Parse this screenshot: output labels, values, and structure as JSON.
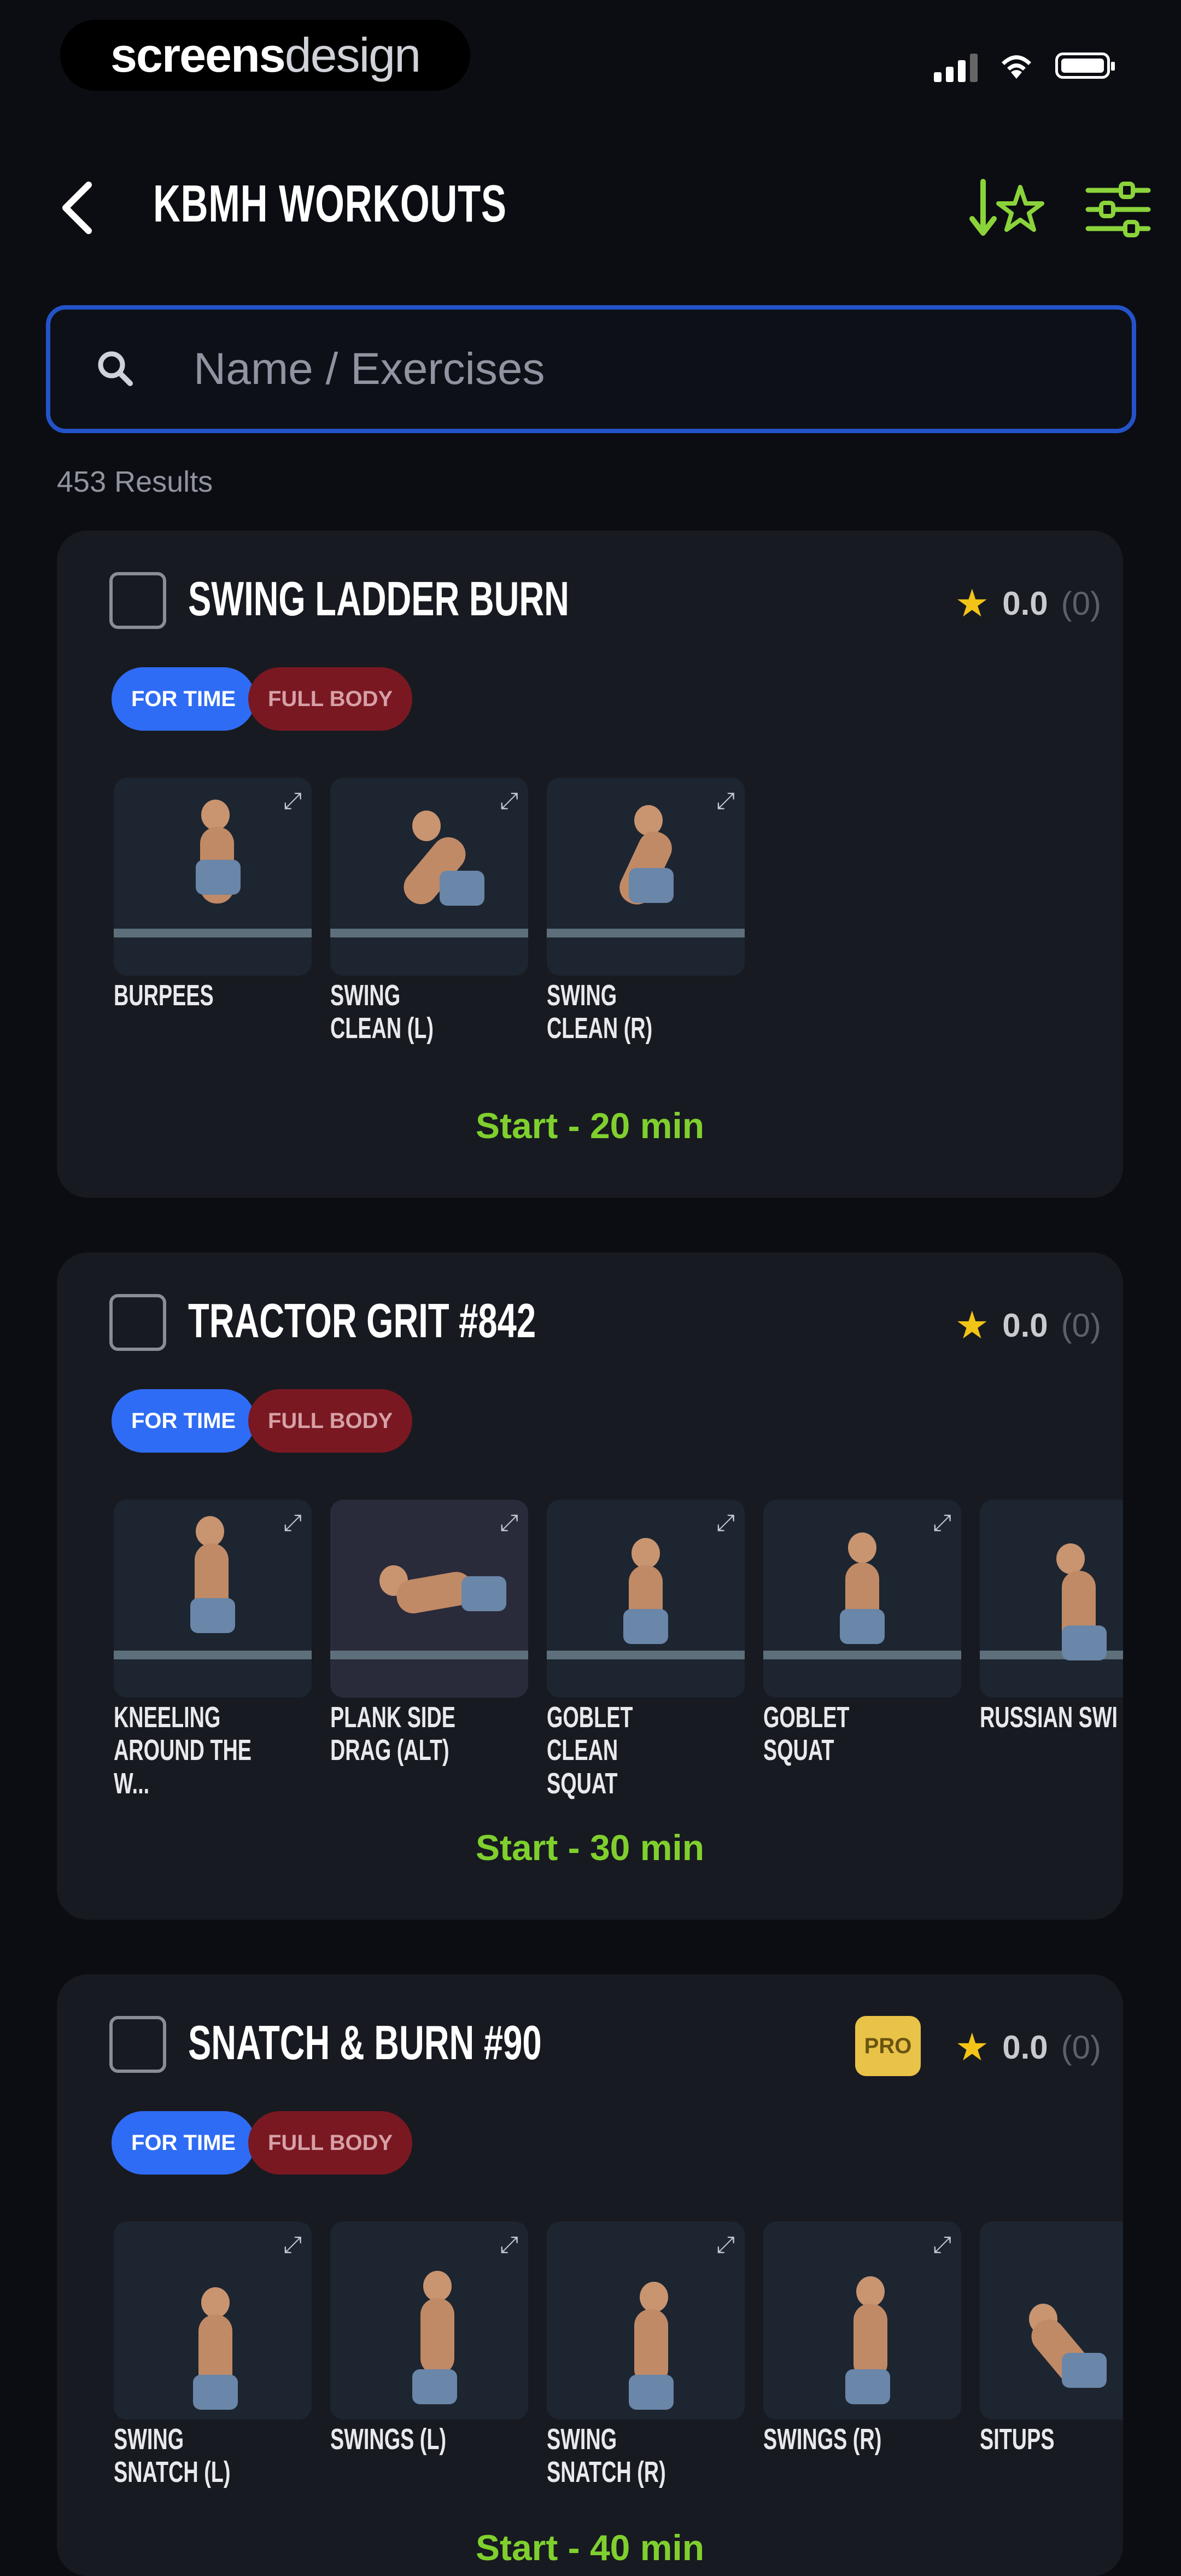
{
  "status_bar": {
    "brand_bold": "screens",
    "brand_light": "design"
  },
  "header": {
    "title": "KBMH WORKOUTS",
    "sort_icon": "sort-star-icon",
    "filter_icon": "filter-sliders-icon"
  },
  "search": {
    "placeholder": "Name / Exercises",
    "value": ""
  },
  "results_label": "453 Results",
  "colors": {
    "accent_green": "#7fd02e",
    "search_border": "#2453c9",
    "tag_blue": "#2f6cf5",
    "tag_red": "#7a1822",
    "star": "#f2c418"
  },
  "workouts": [
    {
      "title": "SWING LADDER BURN",
      "pro": false,
      "rating": "0.0",
      "rating_count": "(0)",
      "tags": [
        "FOR TIME",
        "FULL BODY"
      ],
      "exercises": [
        "BURPEES",
        "SWING CLEAN (L)",
        "SWING CLEAN (R)"
      ],
      "start_label": "Start - 20 min"
    },
    {
      "title": "TRACTOR GRIT #842",
      "pro": false,
      "rating": "0.0",
      "rating_count": "(0)",
      "tags": [
        "FOR TIME",
        "FULL BODY"
      ],
      "exercises": [
        "KNEELING AROUND THE W...",
        "PLANK SIDE DRAG (ALT)",
        "GOBLET CLEAN SQUAT",
        "GOBLET SQUAT",
        "RUSSIAN SWI"
      ],
      "start_label": "Start - 30 min"
    },
    {
      "title": "SNATCH & BURN #90",
      "pro": true,
      "pro_label": "PRO",
      "rating": "0.0",
      "rating_count": "(0)",
      "tags": [
        "FOR TIME",
        "FULL BODY"
      ],
      "exercises": [
        "SWING SNATCH (L)",
        "SWINGS (L)",
        "SWING SNATCH (R)",
        "SWINGS (R)",
        "SITUPS"
      ],
      "start_label": "Start - 40 min"
    }
  ]
}
